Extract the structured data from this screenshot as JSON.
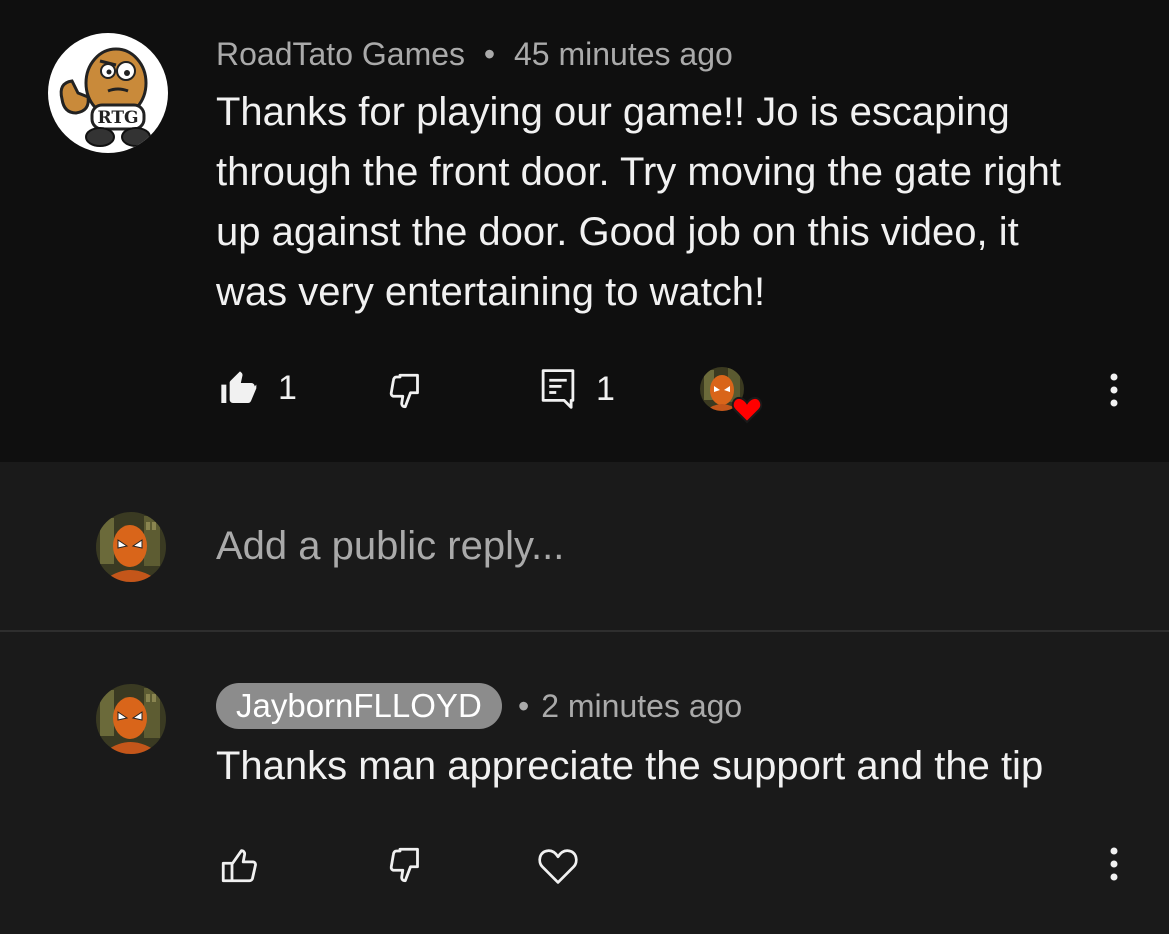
{
  "comment": {
    "author": "RoadTato Games",
    "separator": "•",
    "time": "45 minutes ago",
    "avatar_label": "RTG",
    "text": "Thanks for playing our game!! Jo is escaping\nthrough the front door.  Try moving the gate right\nup against the door. Good job on this video, it\nwas very entertaining to watch!",
    "like_count": "1",
    "reply_count": "1",
    "icons": {
      "like": "thumbs-up-filled-icon",
      "dislike": "thumbs-down-outline-icon",
      "replies": "comment-icon",
      "creator_heart": "creator-heart-icon",
      "more": "more-vert-icon"
    }
  },
  "reply_box": {
    "placeholder": "Add a public reply..."
  },
  "reply": {
    "author": "JaybornFLLOYD",
    "separator": "•",
    "time": "2 minutes ago",
    "text": "Thanks man appreciate the support and the tip",
    "icons": {
      "like": "thumbs-up-outline-icon",
      "dislike": "thumbs-down-outline-icon",
      "heart": "heart-outline-icon",
      "more": "more-vert-icon"
    }
  },
  "colors": {
    "background": "#0f0f0f",
    "reply_background": "#1a1a1a",
    "primary_text": "#f1f1f1",
    "secondary_text": "#aaaaaa",
    "author_chip": "#8c8c8c",
    "heart_red": "#ff0000"
  }
}
